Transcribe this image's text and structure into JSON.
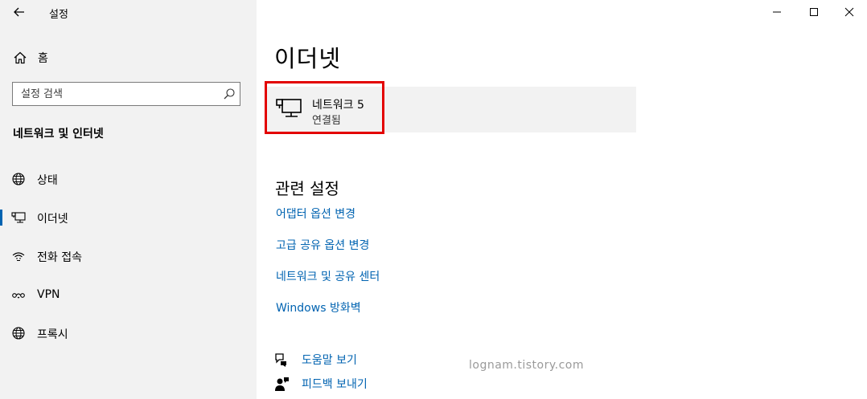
{
  "app": {
    "title": "설정"
  },
  "window_controls": {
    "minimize_icon": "minimize-icon",
    "maximize_icon": "maximize-icon",
    "close_icon": "close-icon"
  },
  "sidebar": {
    "home_label": "홈",
    "search_placeholder": "설정 검색",
    "section_title": "네트워크 및 인터넷",
    "items": [
      {
        "label": "상태",
        "icon": "globe-status-icon",
        "selected": false
      },
      {
        "label": "이더넷",
        "icon": "ethernet-icon",
        "selected": true
      },
      {
        "label": "전화 접속",
        "icon": "dial-up-icon",
        "selected": false
      },
      {
        "label": "VPN",
        "icon": "vpn-icon",
        "selected": false
      },
      {
        "label": "프록시",
        "icon": "globe-icon",
        "selected": false
      }
    ]
  },
  "main": {
    "page_title": "이더넷",
    "network": {
      "name": "네트워크 5",
      "status": "연결됨"
    },
    "related_title": "관련 설정",
    "related_links": [
      "어댑터 옵션 변경",
      "고급 공유 옵션 변경",
      "네트워크 및 공유 센터",
      "Windows 방화벽"
    ],
    "help": {
      "get_help": "도움말 보기",
      "feedback": "피드백 보내기"
    }
  },
  "watermark": "lognam.tistory.com",
  "colors": {
    "accent": "#0063b1",
    "highlight_box": "#e30000",
    "sidebar_bg": "#f2f2f2"
  }
}
